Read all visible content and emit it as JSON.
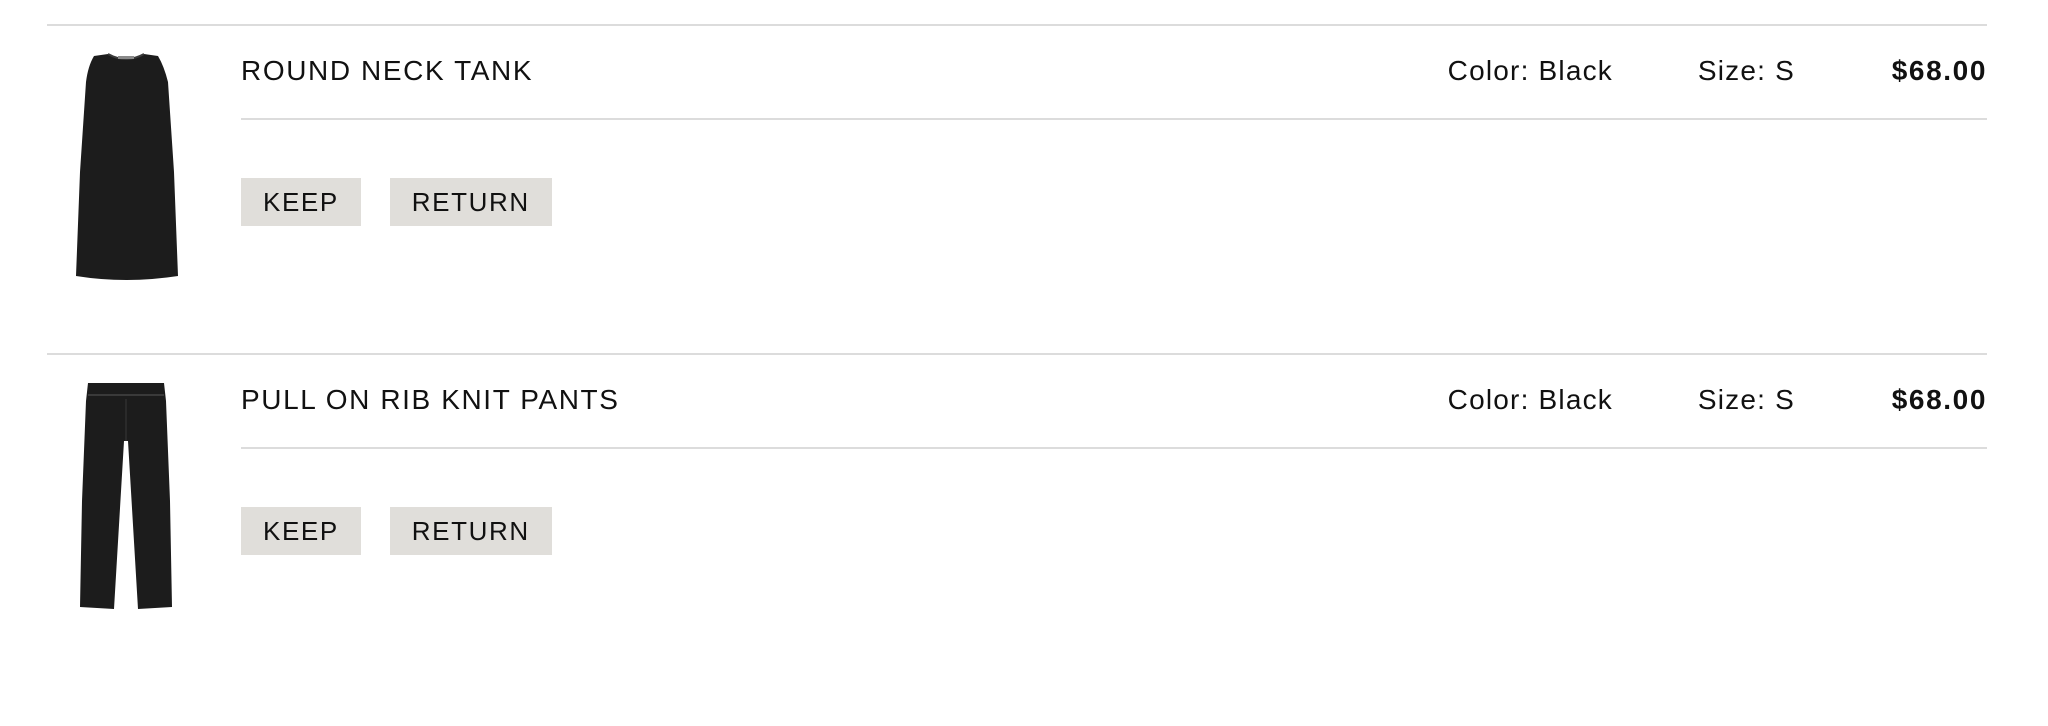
{
  "items": [
    {
      "name": "ROUND NECK TANK",
      "color": "Color: Black",
      "size": "Size: S",
      "price": "$68.00",
      "thumbnail_icon": "black-tank-top-image",
      "keep_label": "KEEP",
      "return_label": "RETURN"
    },
    {
      "name": "PULL ON RIB KNIT PANTS",
      "color": "Color: Black",
      "size": "Size: S",
      "price": "$68.00",
      "thumbnail_icon": "black-pants-image",
      "keep_label": "KEEP",
      "return_label": "RETURN"
    }
  ],
  "colors": {
    "divider": "#dcdcdc",
    "button_bg": "#e0deda",
    "text": "#111111",
    "garment": "#1c1c1c"
  }
}
